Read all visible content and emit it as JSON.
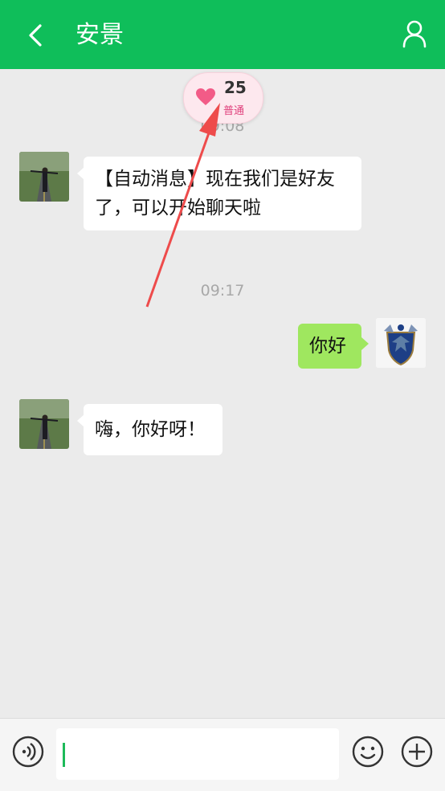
{
  "header": {
    "title": "安景"
  },
  "intimacy": {
    "value": "25",
    "level": "普通"
  },
  "messages": [
    {
      "time": "09:08"
    },
    {
      "side": "left",
      "text": "【自动消息】现在我们是好友了，可以开始聊天啦"
    },
    {
      "time": "09:17"
    },
    {
      "side": "right",
      "text": "你好"
    },
    {
      "side": "left",
      "text": "嗨，你好呀！"
    }
  ],
  "input": {
    "value": ""
  },
  "colors": {
    "header": "#0fbe5a",
    "bubble_right": "#9fe75f",
    "annotation_arrow": "#ee4b4b"
  }
}
